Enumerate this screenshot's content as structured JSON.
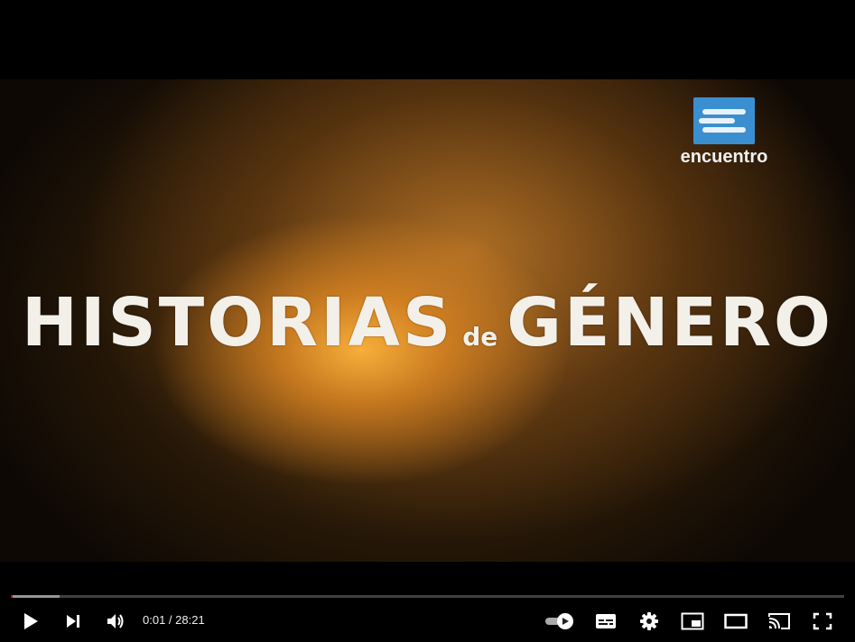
{
  "video": {
    "title_main_left": "HISTORIAS",
    "title_connector": "de",
    "title_main_right": "GÉNERO",
    "channel_logo_text": "encuentro"
  },
  "player": {
    "current_time": "0:01",
    "separator": " / ",
    "duration": "28:21",
    "played_fraction": 0.0006,
    "buffered_fraction": 0.058
  },
  "controls": {
    "icons": [
      "play-icon",
      "next-icon",
      "volume-icon",
      "autoplay-toggle-icon",
      "subtitles-icon",
      "settings-icon",
      "miniplayer-icon",
      "theater-mode-icon",
      "cast-icon",
      "fullscreen-icon"
    ]
  },
  "colors": {
    "progress_played": "#cc0000",
    "logo_blue": "#3a8fd0"
  }
}
